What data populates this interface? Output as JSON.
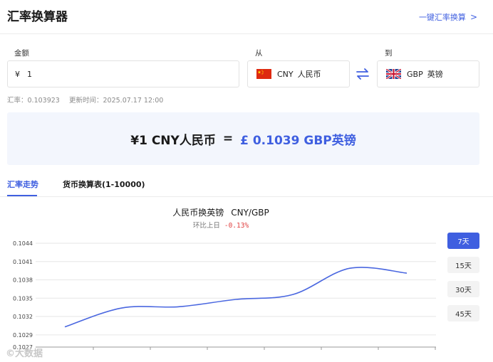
{
  "header": {
    "title": "汇率换算器",
    "link_label": "一键汇率换算",
    "link_chevron": ">"
  },
  "form": {
    "amount_label": "金额",
    "amount_symbol": "¥",
    "amount_value": "1",
    "from_label": "从",
    "to_label": "到",
    "from": {
      "code": "CNY",
      "name": "人民币",
      "flag": "cn-flag-icon"
    },
    "to": {
      "code": "GBP",
      "name": "英镑",
      "flag": "gb-flag-icon"
    },
    "swap_icon": "swap-icon"
  },
  "meta": {
    "rate": "汇率：0.103923",
    "updated": "更新时间：2025.07.17 12:00"
  },
  "result": {
    "from_text": "¥1 CNY人民币",
    "equals": "=",
    "to_text": "£ 0.1039 GBP英镑"
  },
  "tabs": [
    {
      "label": "汇率走势",
      "active": true
    },
    {
      "label": "货币换算表(1-10000)",
      "active": false
    }
  ],
  "chart_header": {
    "title": "人民币换英镑",
    "pair": "CNY/GBP",
    "compare_label": "环比上日",
    "change": "-0.13%"
  },
  "chart_data": {
    "type": "line",
    "title": "人民币换英镑 CNY/GBP",
    "xlabel": "",
    "ylabel": "",
    "ylim": [
      0.1027,
      0.1044
    ],
    "yticks": [
      "0.1044",
      "0.1041",
      "0.1038",
      "0.1035",
      "0.1032",
      "0.1029",
      "0.1027"
    ],
    "x": [
      0,
      1,
      2,
      3,
      4,
      5,
      6
    ],
    "series": [
      {
        "values": [
          0.10303,
          0.10334,
          0.10336,
          0.10348,
          0.10356,
          0.10399,
          0.10391
        ]
      }
    ],
    "grid": true,
    "color": "#4a67e0"
  },
  "range_buttons": [
    {
      "label": "7天",
      "active": true
    },
    {
      "label": "15天",
      "active": false
    },
    {
      "label": "30天",
      "active": false
    },
    {
      "label": "45天",
      "active": false
    }
  ],
  "watermark": "©大数据"
}
